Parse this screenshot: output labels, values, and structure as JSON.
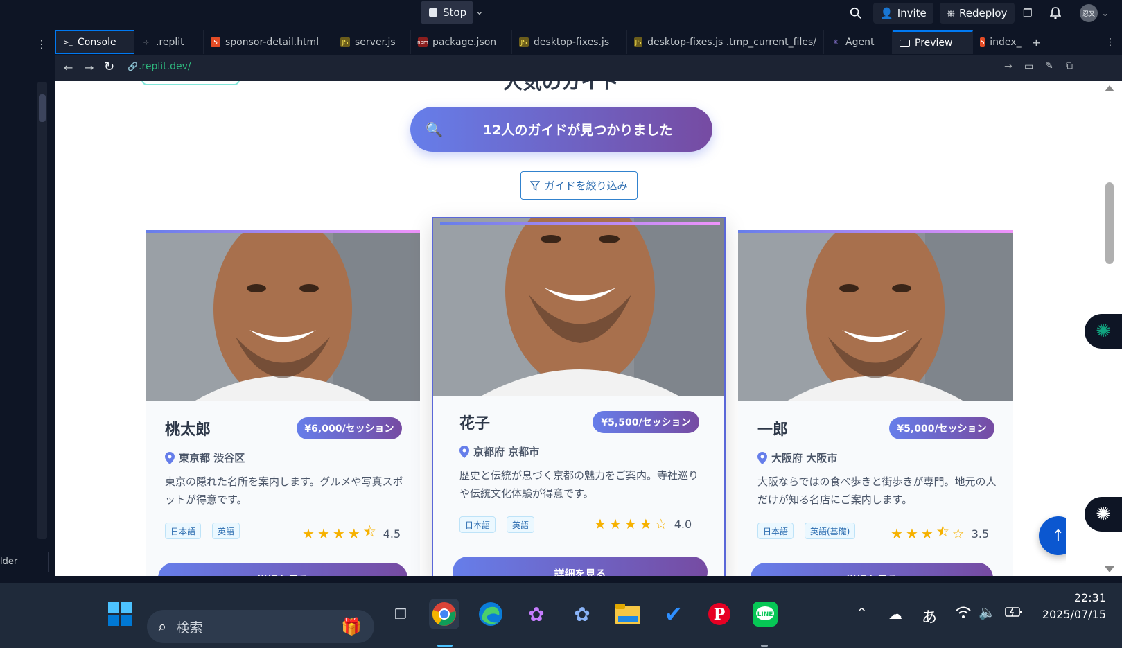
{
  "topbar": {
    "stop_label": "Stop",
    "invite_label": "Invite",
    "redeploy_label": "Redeploy",
    "avatar_text": "忍又"
  },
  "tabs": [
    {
      "label": "Console",
      "icon": "terminal-icon"
    },
    {
      "label": ".replit",
      "icon": "config-icon"
    },
    {
      "label": "sponsor-detail.html",
      "icon": "html-icon"
    },
    {
      "label": "server.js",
      "icon": "js-icon"
    },
    {
      "label": "package.json",
      "icon": "json-icon"
    },
    {
      "label": "desktop-fixes.js",
      "icon": "js-icon"
    },
    {
      "label": "desktop-fixes.js .tmp_current_files/",
      "icon": "js-icon"
    },
    {
      "label": "Agent",
      "icon": "agent-icon"
    },
    {
      "label": "Preview",
      "icon": "preview-icon"
    },
    {
      "label": "index_",
      "icon": "html-icon"
    }
  ],
  "urlbar": {
    "url": ".replit.dev/"
  },
  "left": {
    "bottom_label": "lder"
  },
  "page": {
    "heading_partial": "人気のガイド",
    "results_text": "12人のガイドが見つかりました",
    "filter_label": "ガイドを絞り込み",
    "detail_label": "詳細を見る"
  },
  "guides": [
    {
      "name": "桃太郎",
      "price": "¥6,000/セッション",
      "location": "東京都 渋谷区",
      "description": "東京の隠れた名所を案内します。グルメや写真スポットが得意です。",
      "languages": [
        "日本語",
        "英語"
      ],
      "rating": 4.5,
      "rating_text": "4.5"
    },
    {
      "name": "花子",
      "price": "¥5,500/セッション",
      "location": "京都府 京都市",
      "description": "歴史と伝統が息づく京都の魅力をご案内。寺社巡りや伝統文化体験が得意です。",
      "languages": [
        "日本語",
        "英語"
      ],
      "rating": 4.0,
      "rating_text": "4.0"
    },
    {
      "name": "一郎",
      "price": "¥5,000/セッション",
      "location": "大阪府 大阪市",
      "description": "大阪ならではの食べ歩きと街歩きが専門。地元の人だけが知る名店にご案内します。",
      "languages": [
        "日本語",
        "英語(基礎)"
      ],
      "rating": 3.5,
      "rating_text": "3.5"
    }
  ],
  "taskbar": {
    "search_placeholder": "検索",
    "ime_label": "あ",
    "time": "22:31",
    "date": "2025/07/15"
  },
  "colors": {
    "accent_gradient_start": "#667eea",
    "accent_gradient_end": "#764ba2",
    "scrolltop_button": "#0b57d0"
  }
}
